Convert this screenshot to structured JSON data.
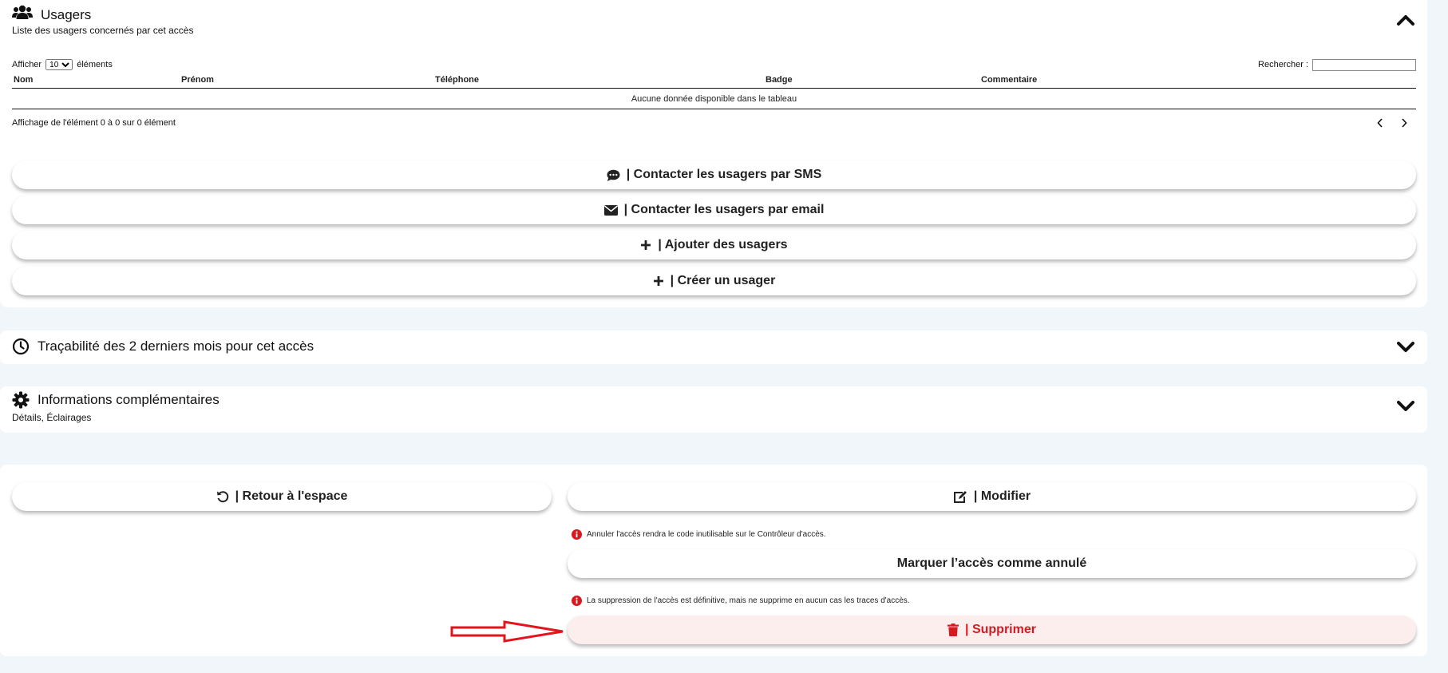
{
  "users": {
    "title": "Usagers",
    "subtitle": "Liste des usagers concernés par cet accès",
    "show_prefix": "Afficher",
    "show_value": "10",
    "show_options": [
      "10"
    ],
    "show_suffix": "éléments",
    "search_label": "Rechercher :",
    "search_value": "",
    "columns": [
      "Nom",
      "Prénom",
      "Téléphone",
      "Badge",
      "Commentaire"
    ],
    "empty_text": "Aucune donnée disponible dans le tableau",
    "info_text": "Affichage de l'élément 0 à 0 sur 0 élément",
    "buttons": {
      "sms": "| Contacter les usagers par SMS",
      "email": "| Contacter les usagers par email",
      "add": "| Ajouter des usagers",
      "create": "| Créer un usager"
    }
  },
  "trace": {
    "title": "Traçabilité des 2 derniers mois pour cet accès"
  },
  "info": {
    "title": "Informations complémentaires",
    "subtitle": "Détails, Éclairages"
  },
  "actions": {
    "back": "| Retour à l'espace",
    "edit": "| Modifier",
    "cancel_note": "Annuler l'accès rendra le code inutilisable sur le Contrôleur d'accès.",
    "cancel": "Marquer l’accès comme annulé",
    "delete_note": "La suppression de l'accès est définitive, mais ne supprime en aucun cas les traces d'accès.",
    "delete": "| Supprimer"
  },
  "colors": {
    "danger": "#d8191f",
    "arrow": "#e3141c",
    "background": "#f1f6fb"
  }
}
